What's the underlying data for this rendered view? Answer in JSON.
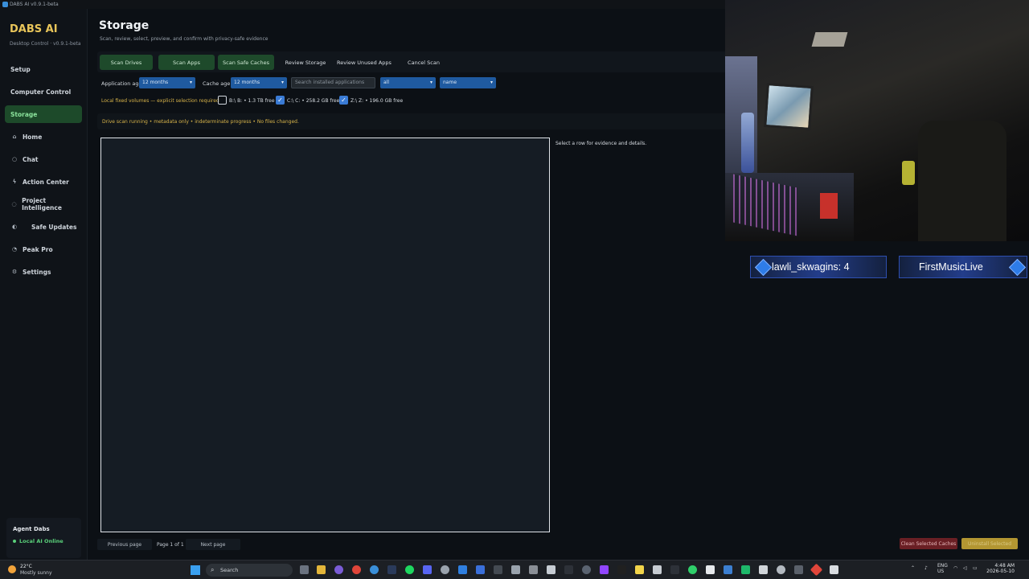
{
  "window": {
    "title": "DABS AI v0.9.1-beta"
  },
  "sidebar": {
    "brand": "DABS AI",
    "brand_sub": "Desktop Control · v0.9.1-beta",
    "items": [
      {
        "label": "Setup",
        "icon": ""
      },
      {
        "label": "Computer Control",
        "icon": ""
      },
      {
        "label": "Storage",
        "icon": "",
        "active": true
      },
      {
        "label": "Home",
        "icon": "home-icon"
      },
      {
        "label": "Chat",
        "icon": "chat-bubble-icon"
      },
      {
        "label": "Action Center",
        "icon": "lightning-icon"
      },
      {
        "label": "Project Intelligence",
        "icon": "brain-icon"
      },
      {
        "label": "Safe Updates",
        "icon": "shield-icon"
      },
      {
        "label": "Peak Pro",
        "icon": "ghost-icon"
      },
      {
        "label": "Settings",
        "icon": "gear-icon"
      }
    ],
    "agent": {
      "title": "Agent Dabs",
      "status": "Local AI Online"
    }
  },
  "main": {
    "title": "Storage",
    "subtitle": "Scan, review, select, preview, and confirm with privacy-safe evidence",
    "toolbar": [
      "Scan Drives",
      "Scan Apps",
      "Scan Safe Caches",
      "Review Storage",
      "Review Unused Apps",
      "Cancel Scan"
    ],
    "filters": {
      "app_age_label": "Application age",
      "app_age_value": "12 months",
      "cache_age_label": "Cache age",
      "cache_age_value": "12 months",
      "search_placeholder": "Search installed applications",
      "type_value": "all",
      "sort_value": "name"
    },
    "volumes": {
      "note": "Local fixed volumes — explicit selection required",
      "items": [
        {
          "label": "B:\\ B: • 1.3 TB free",
          "checked": false
        },
        {
          "label": "C:\\ C: • 258.2 GB free",
          "checked": true
        },
        {
          "label": "Z:\\ Z: • 196.0 GB free",
          "checked": true
        }
      ]
    },
    "status": "Drive scan running • metadata only • indeterminate progress • No files changed.",
    "detail_placeholder": "Select a row for evidence and details.",
    "pager": {
      "prev": "Previous page",
      "info": "Page 1 of 1",
      "next": "Next page"
    },
    "actions": {
      "clean": "Clean Selected Caches",
      "confirm": "Uninstall Selected"
    }
  },
  "overlay": {
    "banner_left": "lawli_skwagins: 4",
    "banner_right": "FirstMusicLive"
  },
  "taskbar": {
    "weather_temp": "22°C",
    "weather_desc": "Mostly sunny",
    "search": "Search",
    "lang": "ENG",
    "region": "US",
    "time": "4:48 AM",
    "date": "2026-05-10"
  },
  "colors": {
    "accent_gold": "#e8c55a",
    "active_green": "#1d4a2a",
    "select_blue": "#1f5aa0",
    "danger": "#6a1f24"
  }
}
